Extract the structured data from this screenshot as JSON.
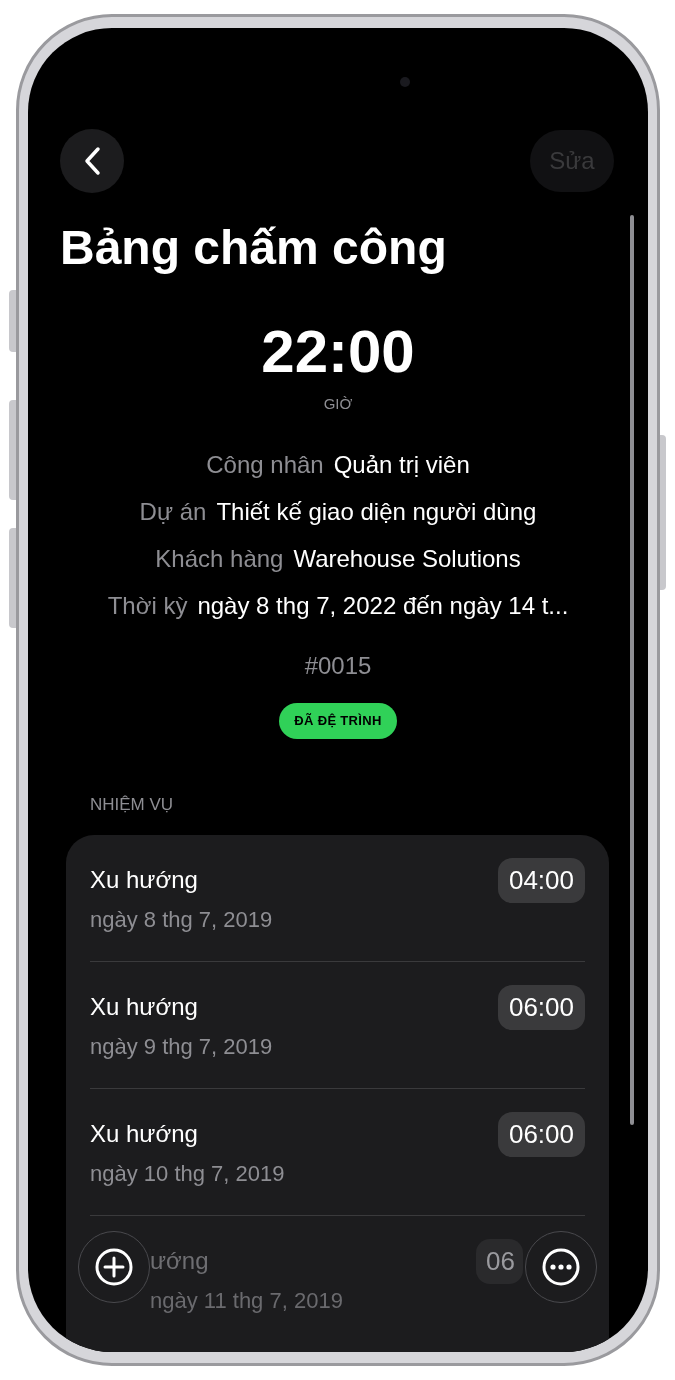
{
  "nav": {
    "edit_button": {
      "label": "Sửa",
      "disabled": true
    }
  },
  "title": "Bảng chấm công",
  "total": {
    "value": "22:00",
    "unit": "GIỜ"
  },
  "details": [
    {
      "label": "Công nhân",
      "value": "Quản trị viên"
    },
    {
      "label": "Dự án",
      "value": "Thiết kế giao diện người dùng"
    },
    {
      "label": "Khách hàng",
      "value": "Warehouse Solutions"
    },
    {
      "label": "Thời kỳ",
      "value": "ngày 8 thg 7, 2022 đến ngày 14 t..."
    }
  ],
  "number": "#0015",
  "status_badge": "ĐÃ ĐỆ TRÌNH",
  "section_header": "NHIỆM VỤ",
  "tasks": [
    {
      "title": "Xu hướng",
      "date": "ngày 8 thg 7, 2019",
      "duration": "04:00",
      "faded": false
    },
    {
      "title": "Xu hướng",
      "date": "ngày 9 thg 7, 2019",
      "duration": "06:00",
      "faded": false
    },
    {
      "title": "Xu hướng",
      "date": "ngày 10 thg 7, 2019",
      "duration": "06:00",
      "faded": false
    },
    {
      "title": "ướng",
      "date": "ngày 11 thg 7, 2019",
      "duration": "06",
      "faded": true
    }
  ]
}
